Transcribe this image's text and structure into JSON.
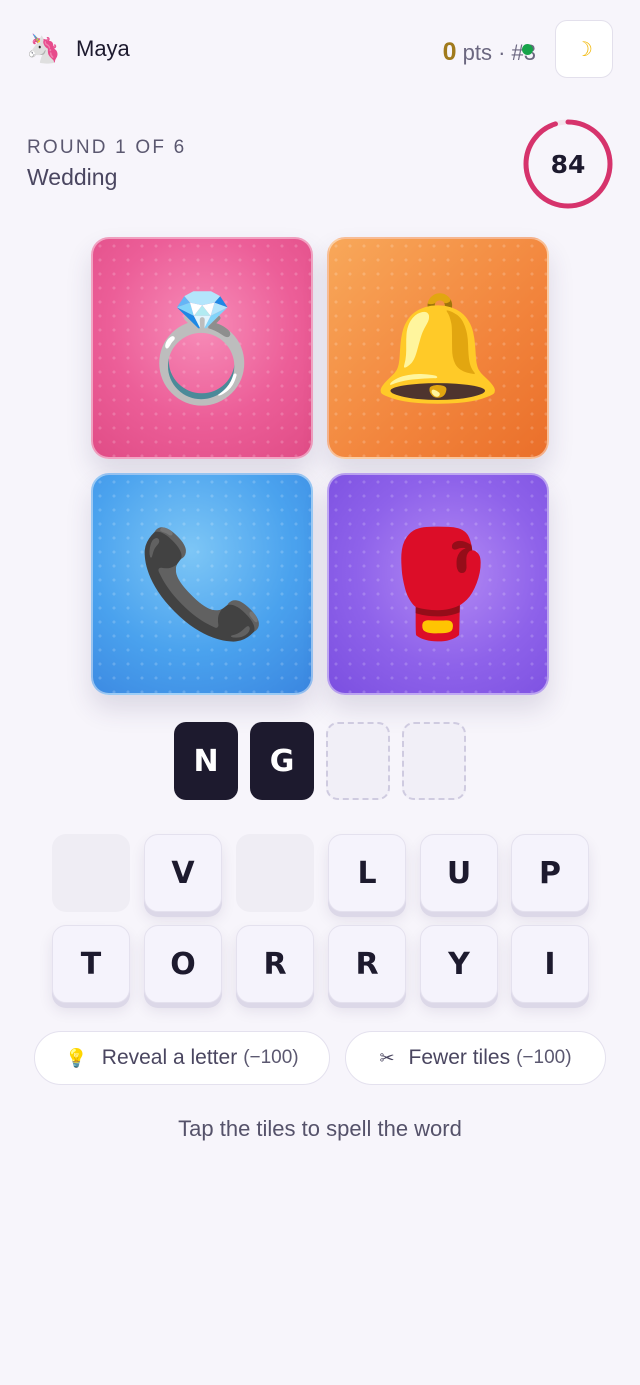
{
  "header": {
    "avatar_emoji": "🦄",
    "avatar_icon": "unicorn-icon",
    "username": "Maya",
    "points": "0",
    "points_suffix": "pts · #3",
    "online_color": "#17a34a",
    "theme_toggle_glyph": "☽",
    "theme_toggle_icon": "moon-icon"
  },
  "round": {
    "label": "ROUND 1 OF 6",
    "category": "Wedding",
    "timer": "84",
    "timer_fraction": 0.95,
    "timer_color": "#d6336c"
  },
  "pictures": [
    {
      "emoji": "💍",
      "icon": "ring-icon",
      "color": "#ec5e98"
    },
    {
      "emoji": "🔔",
      "icon": "bell-icon",
      "color": "#f2843c"
    },
    {
      "emoji": "📞",
      "icon": "telephone-icon",
      "color": "#4aa2ee"
    },
    {
      "emoji": "🥊",
      "icon": "boxing-glove-icon",
      "color": "#8e62ea"
    }
  ],
  "answer": {
    "slots": [
      "N",
      "G",
      "",
      ""
    ]
  },
  "letters": {
    "row1": [
      "",
      "V",
      "",
      "L",
      "U",
      "P"
    ],
    "row2": [
      "T",
      "O",
      "R",
      "R",
      "Y",
      "I"
    ]
  },
  "hints": {
    "reveal_label": "Reveal a letter",
    "reveal_cost": "(−100)",
    "reveal_icon_glyph": "💡",
    "fewer_label": "Fewer tiles",
    "fewer_cost": "(−100)",
    "fewer_icon_glyph": "✂"
  },
  "instruction": "Tap the tiles to spell the word"
}
